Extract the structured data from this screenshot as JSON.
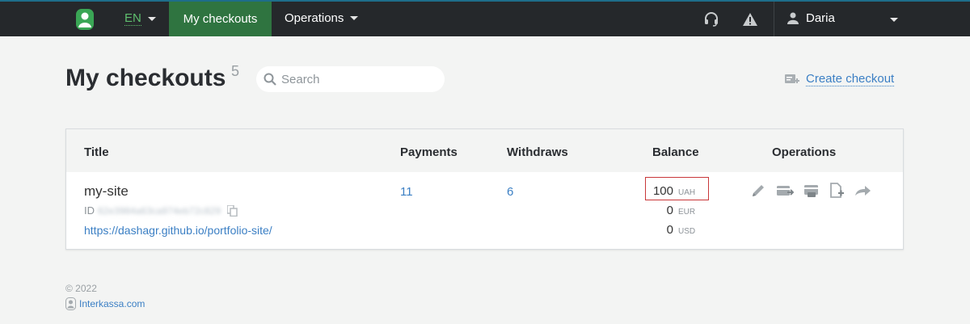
{
  "nav": {
    "lang": "EN",
    "active_tab": "My checkouts",
    "operations": "Operations",
    "user_name": "Daria",
    "icons": [
      "headset-icon",
      "warning-icon",
      "user-icon"
    ]
  },
  "header": {
    "title": "My checkouts",
    "count": "5",
    "search_placeholder": "Search",
    "create_label": "Create checkout"
  },
  "table": {
    "columns": [
      "Title",
      "Payments",
      "Withdraws",
      "Balance",
      "Operations"
    ],
    "rows": [
      {
        "title": "my-site",
        "id_label": "ID",
        "id_value": "62e3984a63ca974eb72c829",
        "url": "https://dashagr.github.io/portfolio-site/",
        "payments": "11",
        "withdraws": "6",
        "balances": [
          {
            "amount": "100",
            "currency": "UAH"
          },
          {
            "amount": "0",
            "currency": "EUR"
          },
          {
            "amount": "0",
            "currency": "USD"
          }
        ],
        "operations": [
          "edit-icon",
          "payment-card-icon",
          "withdraw-card-icon",
          "document-add-icon",
          "forward-icon"
        ]
      }
    ]
  },
  "footer": {
    "copyright": "© 2022",
    "brand": "Interkassa.com"
  },
  "colors": {
    "nav_bg": "#25282b",
    "active_tab": "#2f7440",
    "link": "#3b7fc4",
    "highlight_border": "#c9383a"
  }
}
